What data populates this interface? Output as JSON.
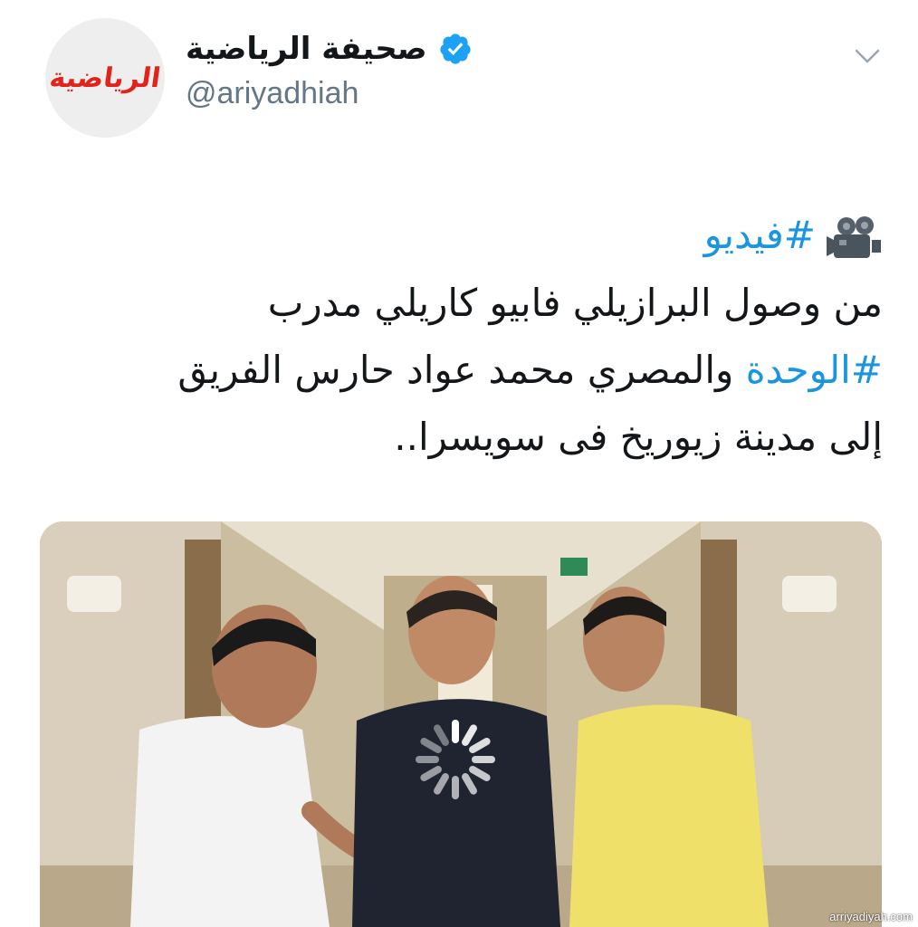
{
  "profile": {
    "display_name": "صحيفة الرياضية",
    "handle": "@ariyadhiah",
    "avatar_logo_text": "الرياضية",
    "verified": true
  },
  "tweet": {
    "hashtag_video": "#فيديو",
    "line2": "من وصول البرازيلي فابيو كاريلي مدرب",
    "hashtag_team": "#الوحدة",
    "line3_rest": " والمصري محمد عواد حارس الفريق",
    "line4": "إلى مدينة زيوريخ فى سويسرا.."
  },
  "media": {
    "type": "video",
    "loading": true
  },
  "watermark": "arriyadiyah.com",
  "colors": {
    "hashtag": "#1b95e0",
    "verified_badge": "#1da1f2",
    "handle": "#657786",
    "brand_red": "#e2231a"
  },
  "icons": [
    "verified-badge-icon",
    "chevron-down-icon",
    "movie-camera-icon",
    "loading-spinner-icon"
  ]
}
